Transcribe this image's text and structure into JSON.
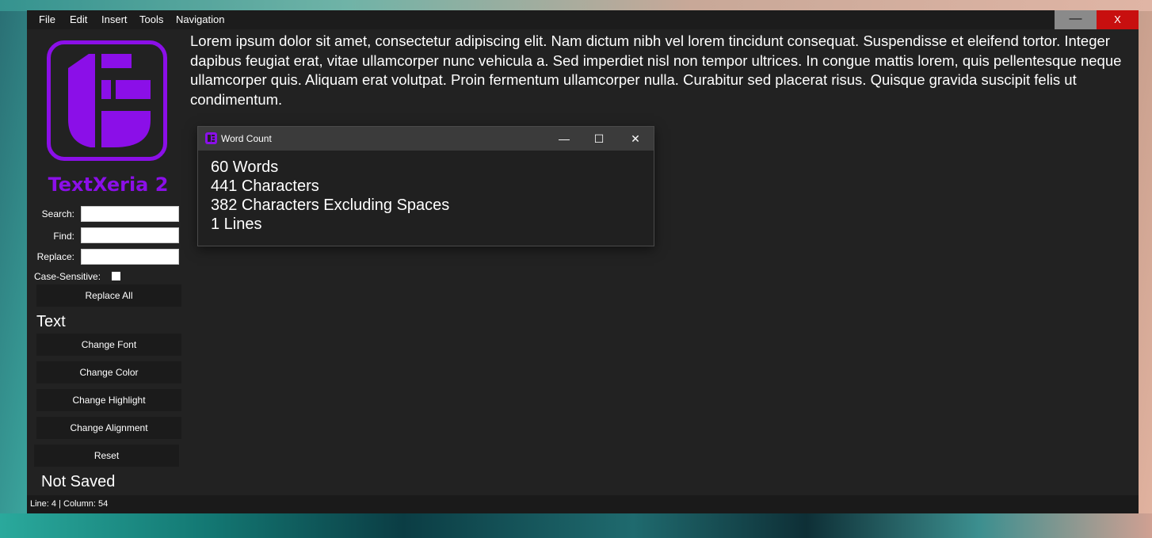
{
  "menu": [
    "File",
    "Edit",
    "Insert",
    "Tools",
    "Navigation"
  ],
  "window_controls": {
    "minimize": "—",
    "close": "X"
  },
  "app_name": "TextXeria 2",
  "search": {
    "search_label": "Search:",
    "find_label": "Find:",
    "replace_label": "Replace:",
    "case_label": "Case-Sensitive:",
    "search_value": "",
    "find_value": "",
    "replace_value": "",
    "case_checked": false
  },
  "buttons": {
    "replace_all": "Replace All",
    "change_font": "Change Font",
    "change_color": "Change Color",
    "change_highlight": "Change Highlight",
    "change_alignment": "Change Alignment",
    "reset": "Reset"
  },
  "section_text": "Text",
  "save_status": "Not Saved",
  "document_text": "Lorem ipsum dolor sit amet, consectetur adipiscing elit. Nam dictum nibh vel lorem tincidunt consequat. Suspendisse et eleifend tortor. Integer dapibus feugiat erat, vitae ullamcorper nunc vehicula a. Sed imperdiet nisl non tempor ultrices. In congue mattis lorem, quis pellentesque neque ullamcorper quis. Aliquam erat volutpat. Proin fermentum ullamcorper nulla. Curabitur sed placerat risus. Quisque gravida suscipit felis ut condimentum.",
  "status_bar": "Line: 4 | Column: 54",
  "word_count_dialog": {
    "title": "Word Count",
    "controls": {
      "minimize": "—",
      "maximize": "☐",
      "close": "✕"
    },
    "lines": [
      "60 Words",
      "441 Characters",
      "382 Characters Excluding Spaces",
      "1 Lines"
    ]
  },
  "colors": {
    "accent": "#8b0fe8",
    "close_red": "#c80f0f",
    "background": "#222222"
  }
}
